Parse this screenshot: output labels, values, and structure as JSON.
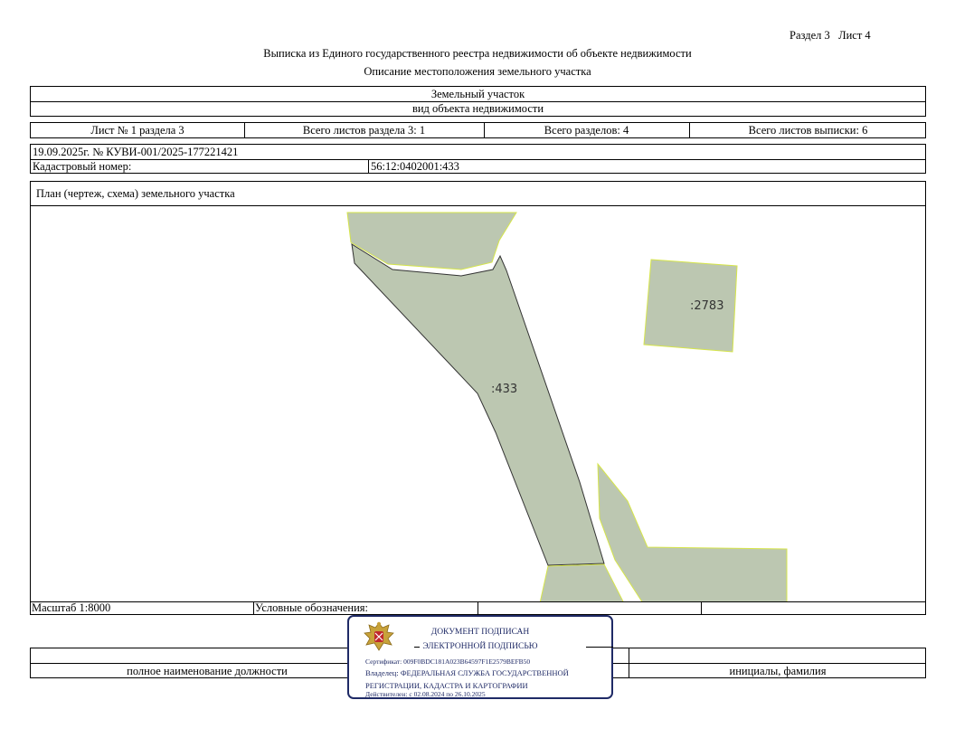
{
  "header": {
    "section_sheet": "Раздел 3   Лист 4",
    "title": "Выписка из Единого государственного реестра недвижимости об объекте недвижимости",
    "subtitle": "Описание местоположения земельного участка"
  },
  "object": {
    "type": "Земельный участок",
    "type_label": "вид объекта недвижимости"
  },
  "sheets": {
    "sheet": "Лист № 1 раздела 3",
    "total_section_sheets": "Всего листов раздела 3: 1",
    "total_sections": "Всего разделов: 4",
    "total_extract_sheets": "Всего листов выписки: 6"
  },
  "record": {
    "date_number": "19.09.2025г. № КУВИ-001/2025-177221421",
    "cadastral_label": "Кадастровый номер:",
    "cadastral_value": "56:12:0402001:433"
  },
  "plan": {
    "title": "План (чертеж, схема) земельного участка",
    "parcel_main_label": ":433",
    "parcel_other_label": ":2783",
    "fill_color": "#bcc7b1",
    "outline_color": "#d6e54a"
  },
  "footer": {
    "scale": "Масштаб 1:8000",
    "legend_label": "Условные обозначения:",
    "position_caption": "полное наименование должности",
    "initials_caption": "инициалы, фамилия"
  },
  "stamp": {
    "line1": "ДОКУМЕНТ ПОДПИСАН",
    "line2": "ЭЛЕКТРОННОЙ ПОДПИСЬЮ",
    "certificate": "Сертификат: 009F0BDC181A023B64597F1E2579BEFB50",
    "owner_line1": "Владелец: ФЕДЕРАЛЬНАЯ СЛУЖБА ГОСУДАРСТВЕННОЙ",
    "owner_line2": "РЕГИСТРАЦИИ, КАДАСТРА И КАРТОГРАФИИ",
    "valid": "Действителен: с 02.08.2024 по 26.10.2025",
    "color": "#1f2a66"
  }
}
